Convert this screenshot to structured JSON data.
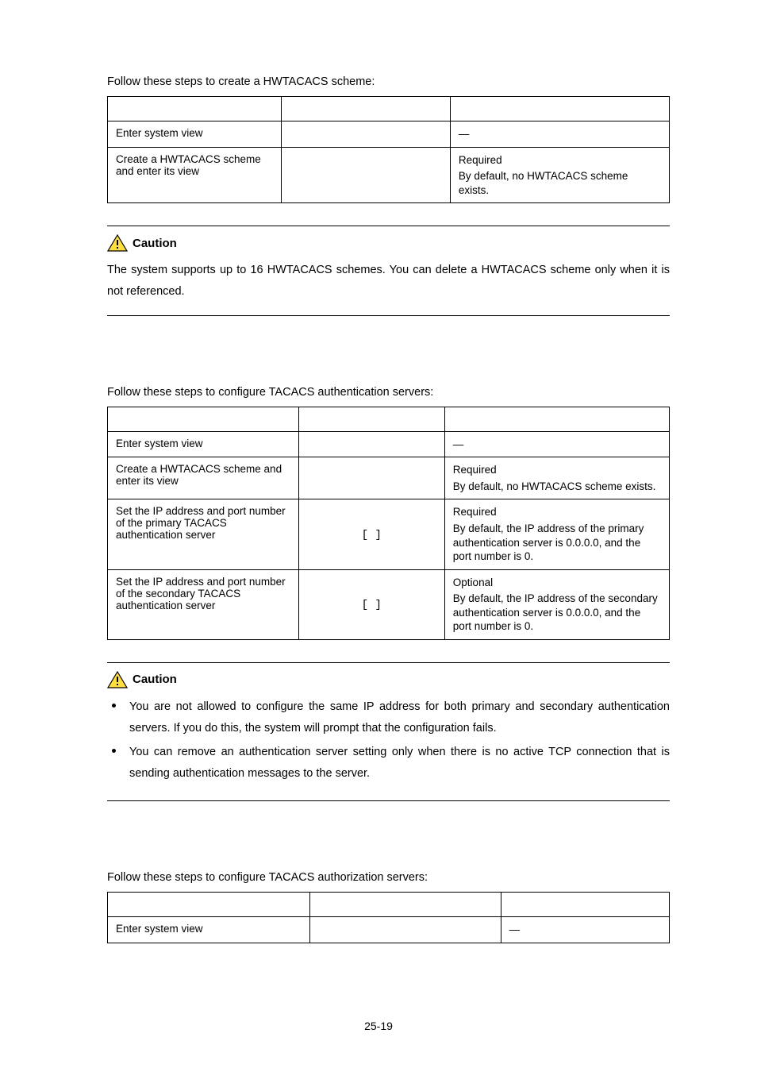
{
  "section1": {
    "intro": "Follow these steps to create a HWTACACS scheme:",
    "rows": [
      {
        "c1": "Enter system view",
        "c2": "",
        "c3": [
          "—"
        ]
      },
      {
        "c1": "Create a HWTACACS scheme and enter its view",
        "c2": "",
        "c3": [
          "Required",
          "By default, no HWTACACS scheme exists."
        ]
      }
    ]
  },
  "caution_label": "Caution",
  "caution1": {
    "text": "The system supports up to 16 HWTACACS schemes. You can delete a HWTACACS scheme only when it is not referenced."
  },
  "section2": {
    "intro": "Follow these steps to configure TACACS authentication servers:",
    "rows": [
      {
        "c1": "Enter system view",
        "c2": "",
        "c3": [
          "—"
        ]
      },
      {
        "c1": "Create a HWTACACS scheme and enter its view",
        "c2": "",
        "c3": [
          "Required",
          "By default, no HWTACACS scheme exists."
        ]
      },
      {
        "c1": "Set the IP address and port number of the primary TACACS authentication server",
        "c2": "[   ]",
        "c3": [
          "Required",
          "By default, the IP address of the primary authentication server is 0.0.0.0, and the port number is 0."
        ]
      },
      {
        "c1": "Set the IP address and port number of the secondary TACACS authentication server",
        "c2": "[   ]",
        "c3": [
          "Optional",
          "By default, the IP address of the secondary authentication server is 0.0.0.0, and the port number is 0."
        ]
      }
    ]
  },
  "caution2": {
    "bullets": [
      "You are not allowed to configure the same IP address for both primary and secondary authentication servers. If you do this, the system will prompt that the configuration fails.",
      "You can remove an authentication server setting only when there is no active TCP connection that is sending authentication messages to the server."
    ]
  },
  "section3": {
    "intro": "Follow these steps to configure TACACS authorization servers:",
    "rows": [
      {
        "c1": "Enter system view",
        "c2": "",
        "c3": [
          "—"
        ]
      }
    ]
  },
  "footer": "25-19"
}
